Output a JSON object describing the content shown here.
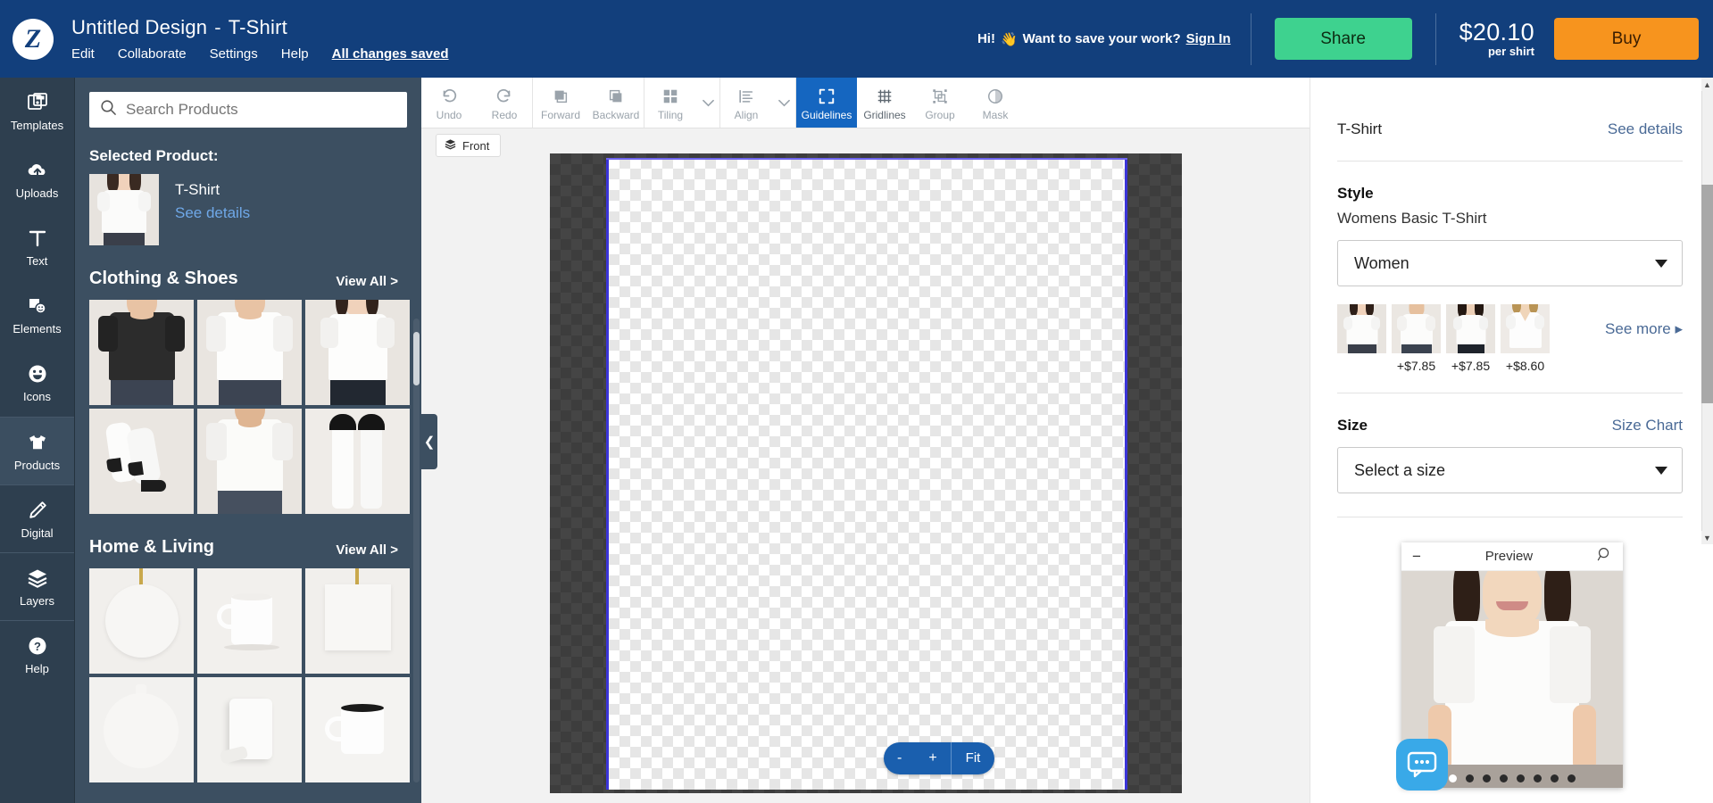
{
  "header": {
    "logo_text": "Z",
    "doc_title": "Untitled Design",
    "title_separator": "-",
    "product_title": "T-Shirt",
    "menu": [
      {
        "label": "Edit"
      },
      {
        "label": "Collaborate"
      },
      {
        "label": "Settings"
      },
      {
        "label": "Help"
      }
    ],
    "saved_status": "All changes saved",
    "greeting_prefix": "Hi!",
    "greeting_emoji": "👋",
    "greeting_text": "Want to save your work?",
    "sign_in": "Sign In",
    "share_label": "Share",
    "price_amount": "$20.10",
    "price_unit": "per shirt",
    "buy_label": "Buy",
    "brand_blue": "#123f7c",
    "share_green": "#3ed28f",
    "buy_orange": "#f7941e"
  },
  "rail": {
    "items": [
      {
        "label": "Templates",
        "icon": "templates-icon",
        "active": false
      },
      {
        "label": "Uploads",
        "icon": "upload-cloud-icon",
        "active": false
      },
      {
        "label": "Text",
        "icon": "text-icon",
        "active": false
      },
      {
        "label": "Elements",
        "icon": "elements-icon",
        "active": false
      },
      {
        "label": "Icons",
        "icon": "smiley-icon",
        "active": false
      },
      {
        "label": "Products",
        "icon": "tshirt-icon",
        "active": true
      },
      {
        "label": "Digital",
        "icon": "pencil-icon",
        "active": false
      },
      {
        "label": "Layers",
        "icon": "layers-icon",
        "active": false
      },
      {
        "label": "Help",
        "icon": "question-circle-icon",
        "active": false
      }
    ]
  },
  "panel": {
    "search_placeholder": "Search Products",
    "search_value": "",
    "selected_label": "Selected Product:",
    "selected_name": "T-Shirt",
    "selected_details_link": "See details",
    "categories": [
      {
        "title": "Clothing & Shoes",
        "view_all": "View All >",
        "tiles": [
          {
            "name": "black-tshirt-male"
          },
          {
            "name": "white-tshirt-male"
          },
          {
            "name": "white-tshirt-female"
          },
          {
            "name": "white-socks-pair"
          },
          {
            "name": "white-tshirt-male-alt"
          },
          {
            "name": "white-knee-socks"
          }
        ]
      },
      {
        "title": "Home & Living",
        "view_all": "View All >",
        "tiles": [
          {
            "name": "round-ornament"
          },
          {
            "name": "white-mug"
          },
          {
            "name": "square-ornament"
          },
          {
            "name": "round-ornament-plain"
          },
          {
            "name": "throw-pillow"
          },
          {
            "name": "black-rim-mug"
          }
        ]
      }
    ],
    "collapse_icon": "chevron-left-icon"
  },
  "toolbar": {
    "groups": [
      {
        "buttons": [
          {
            "label": "Undo",
            "icon": "undo-icon",
            "state": "disabled"
          },
          {
            "label": "Redo",
            "icon": "redo-icon",
            "state": "disabled"
          }
        ]
      },
      {
        "buttons": [
          {
            "label": "Forward",
            "icon": "bring-forward-icon",
            "state": "disabled"
          },
          {
            "label": "Backward",
            "icon": "send-backward-icon",
            "state": "disabled"
          }
        ]
      },
      {
        "buttons": [
          {
            "label": "Tiling",
            "icon": "tiling-icon",
            "state": "disabled",
            "caret": true
          }
        ]
      },
      {
        "buttons": [
          {
            "label": "Align",
            "icon": "align-icon",
            "state": "disabled",
            "caret": true
          }
        ]
      },
      {
        "buttons": [
          {
            "label": "Guidelines",
            "icon": "guidelines-icon",
            "state": "active"
          },
          {
            "label": "Gridlines",
            "icon": "gridlines-icon",
            "state": "enabled"
          },
          {
            "label": "Group",
            "icon": "group-icon",
            "state": "disabled"
          },
          {
            "label": "Mask",
            "icon": "mask-icon",
            "state": "disabled"
          }
        ]
      }
    ]
  },
  "canvas": {
    "side_tab": "Front",
    "side_tab_icon": "layers-small-icon",
    "zoom_out": "-",
    "zoom_in": "+",
    "zoom_fit": "Fit"
  },
  "right_panel": {
    "product_name": "T-Shirt",
    "see_details": "See details",
    "style_title": "Style",
    "style_value": "Womens Basic T-Shirt",
    "style_select_value": "Women",
    "see_more": "See more ▸",
    "swatches": [
      {
        "name": "womens-basic-tshirt",
        "price": "",
        "selected": true
      },
      {
        "name": "mens-basic-tshirt",
        "price": "+$7.85",
        "selected": false
      },
      {
        "name": "womens-fitted-tshirt",
        "price": "+$7.85",
        "selected": false
      },
      {
        "name": "womens-v-neck-tshirt",
        "price": "+$8.60",
        "selected": false
      }
    ],
    "size_title": "Size",
    "size_chart": "Size Chart",
    "size_select_value": "Select a size"
  },
  "preview": {
    "title": "Preview",
    "minimize_icon": "minimize-icon",
    "zoom_icon": "magnifier-icon",
    "dot_count": 8,
    "active_dot": 0,
    "chat_icon": "chat-bubble-icon"
  }
}
